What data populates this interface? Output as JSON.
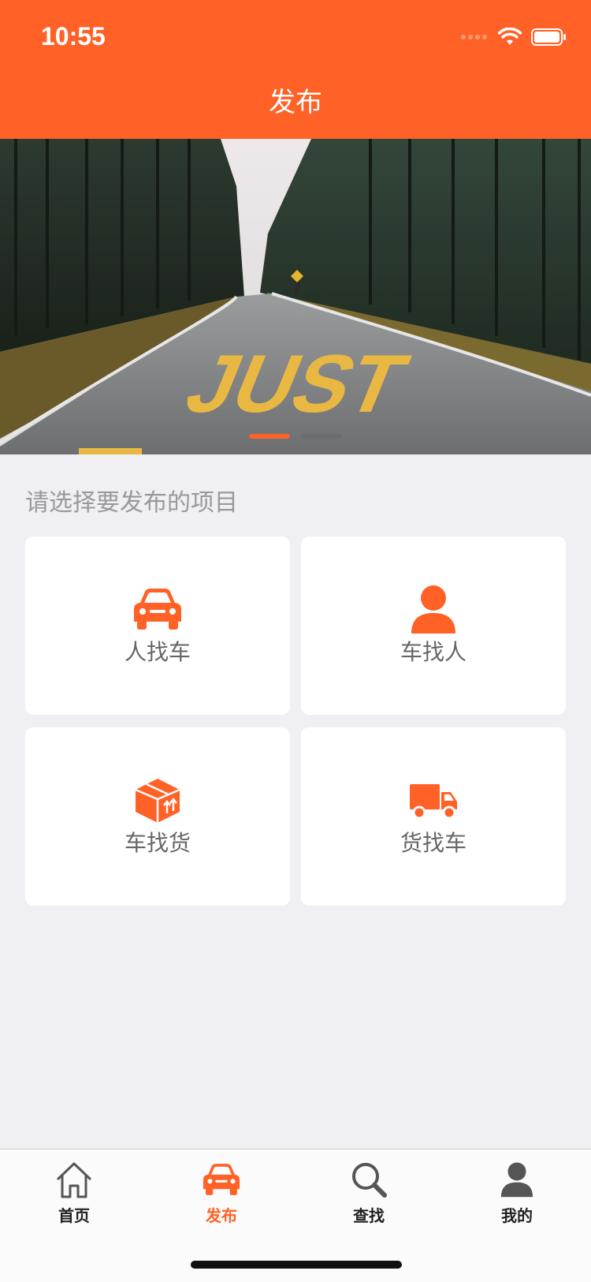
{
  "status_bar": {
    "time": "10:55"
  },
  "nav": {
    "title": "发布"
  },
  "banner": {
    "road_text": "JUST",
    "slides": 2,
    "active_slide": 1
  },
  "section": {
    "title": "请选择要发布的项目"
  },
  "options": [
    {
      "label": "人找车",
      "icon": "car-icon"
    },
    {
      "label": "车找人",
      "icon": "person-icon"
    },
    {
      "label": "车找货",
      "icon": "package-icon"
    },
    {
      "label": "货找车",
      "icon": "truck-icon"
    }
  ],
  "tabs": [
    {
      "label": "首页",
      "icon": "home-icon",
      "active": false
    },
    {
      "label": "发布",
      "icon": "car-icon",
      "active": true
    },
    {
      "label": "查找",
      "icon": "search-icon",
      "active": false
    },
    {
      "label": "我的",
      "icon": "profile-icon",
      "active": false
    }
  ],
  "colors": {
    "accent": "#ff6126",
    "background": "#efeff4",
    "card": "#ffffff",
    "section_text": "#999999"
  }
}
